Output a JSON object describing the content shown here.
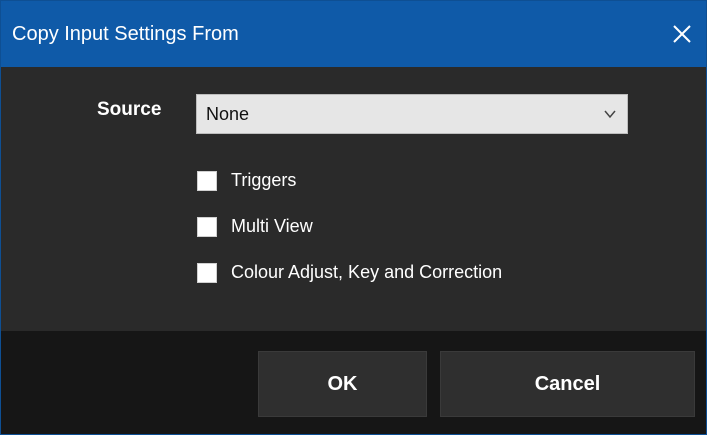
{
  "window": {
    "title": "Copy Input Settings From",
    "close_icon": "close-icon"
  },
  "source": {
    "label": "Source",
    "selected": "None",
    "dropdown_icon": "chevron-down-icon"
  },
  "options": [
    {
      "label": "Triggers",
      "checked": false
    },
    {
      "label": "Multi View",
      "checked": false
    },
    {
      "label": "Colour Adjust, Key and Correction",
      "checked": false
    }
  ],
  "buttons": {
    "ok": "OK",
    "cancel": "Cancel"
  },
  "colors": {
    "titlebar": "#0f5aa8",
    "background": "#2a2a2a",
    "footer": "#161616",
    "button": "#2f2f2f"
  }
}
